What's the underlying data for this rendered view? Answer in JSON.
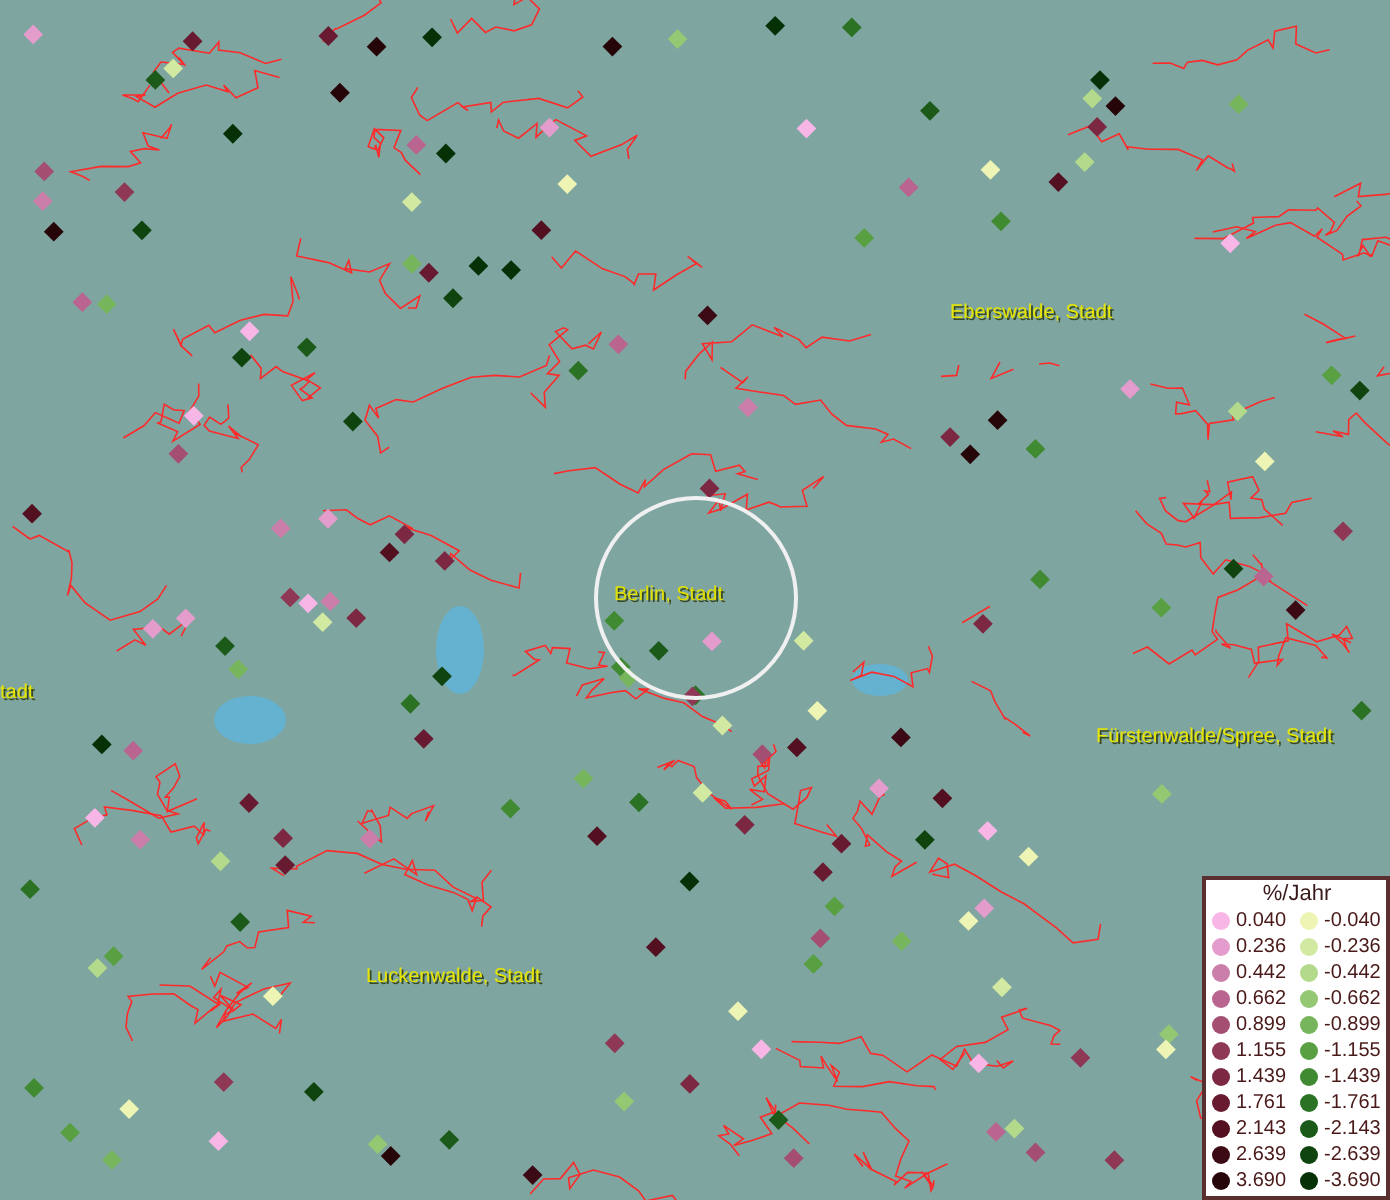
{
  "map": {
    "places": [
      {
        "name": "Eberswalde, Stadt",
        "kind": "town"
      },
      {
        "name": "Berlin, Stadt",
        "kind": "focus"
      },
      {
        "name": "tadt",
        "kind": "town"
      },
      {
        "name": "Fürstenwalde/Spree, Stadt",
        "kind": "town"
      },
      {
        "name": "Luckenwalde, Stadt",
        "kind": "town"
      }
    ]
  },
  "legend": {
    "title": "%/Jahr",
    "columns": [
      [
        {
          "label": "0.040",
          "color": "#f7b6e6"
        },
        {
          "label": "0.236",
          "color": "#e39ccb"
        },
        {
          "label": "0.442",
          "color": "#cc7eaa"
        },
        {
          "label": "0.662",
          "color": "#b96590"
        },
        {
          "label": "0.899",
          "color": "#a44e72"
        },
        {
          "label": "1.155",
          "color": "#8f3856"
        },
        {
          "label": "1.439",
          "color": "#7c2842"
        },
        {
          "label": "1.761",
          "color": "#681b30"
        },
        {
          "label": "2.143",
          "color": "#521020"
        },
        {
          "label": "2.639",
          "color": "#3c0a14"
        },
        {
          "label": "3.690",
          "color": "#260508"
        }
      ],
      [
        {
          "label": "-0.040",
          "color": "#eef5b4"
        },
        {
          "label": "-0.236",
          "color": "#d2e9a2"
        },
        {
          "label": "-0.442",
          "color": "#b3da8b"
        },
        {
          "label": "-0.662",
          "color": "#94c873"
        },
        {
          "label": "-0.899",
          "color": "#76b55b"
        },
        {
          "label": "-1.155",
          "color": "#58a042"
        },
        {
          "label": "-1.439",
          "color": "#408a32"
        },
        {
          "label": "-1.761",
          "color": "#2b7224"
        },
        {
          "label": "-2.143",
          "color": "#1b5a18"
        },
        {
          "label": "-2.639",
          "color": "#0f440f"
        },
        {
          "label": "-3.690",
          "color": "#063006"
        }
      ]
    ]
  }
}
